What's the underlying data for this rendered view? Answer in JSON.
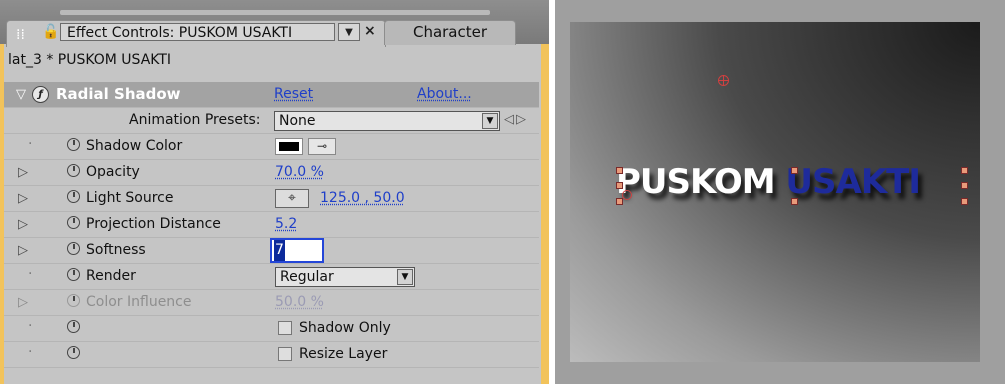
{
  "panel": {
    "tab_title": "Effect Controls: PUSKOM USAKTI",
    "tab_close": "×",
    "inactive_tab": "Character",
    "composition_path": "lat_3 * PUSKOM USAKTI"
  },
  "effect": {
    "name": "Radial Shadow",
    "reset_label": "Reset",
    "about_label": "About...",
    "presets_label": "Animation Presets:",
    "presets_value": "None"
  },
  "properties": {
    "shadow_color": {
      "label": "Shadow Color",
      "value": "#000000"
    },
    "opacity": {
      "label": "Opacity",
      "value": "70.0 %"
    },
    "light_source": {
      "label": "Light Source",
      "value": "125.0 , 50.0"
    },
    "projection_distance": {
      "label": "Projection Distance",
      "value": "5.2"
    },
    "softness": {
      "label": "Softness",
      "value": "7"
    },
    "render": {
      "label": "Render",
      "value": "Regular"
    },
    "color_influence": {
      "label": "Color Influence",
      "value": "50.0 %"
    },
    "shadow_only": {
      "label": "Shadow Only",
      "checked": false
    },
    "resize_layer": {
      "label": "Resize Layer",
      "checked": false
    }
  },
  "viewer": {
    "text_word1": "PUSKOM",
    "text_word2": "USAKTI"
  },
  "colors": {
    "panel_bg": "#c5c5c5",
    "accent_edge": "#f2c35b",
    "link_blue": "#1f3fc9",
    "text_blue": "#1e2b9b"
  },
  "icons": [
    "stopwatch-icon",
    "twirl-arrow-icon",
    "fx-icon",
    "eyedropper-icon",
    "crosshair-icon",
    "lock-icon",
    "chevron-down-icon"
  ]
}
